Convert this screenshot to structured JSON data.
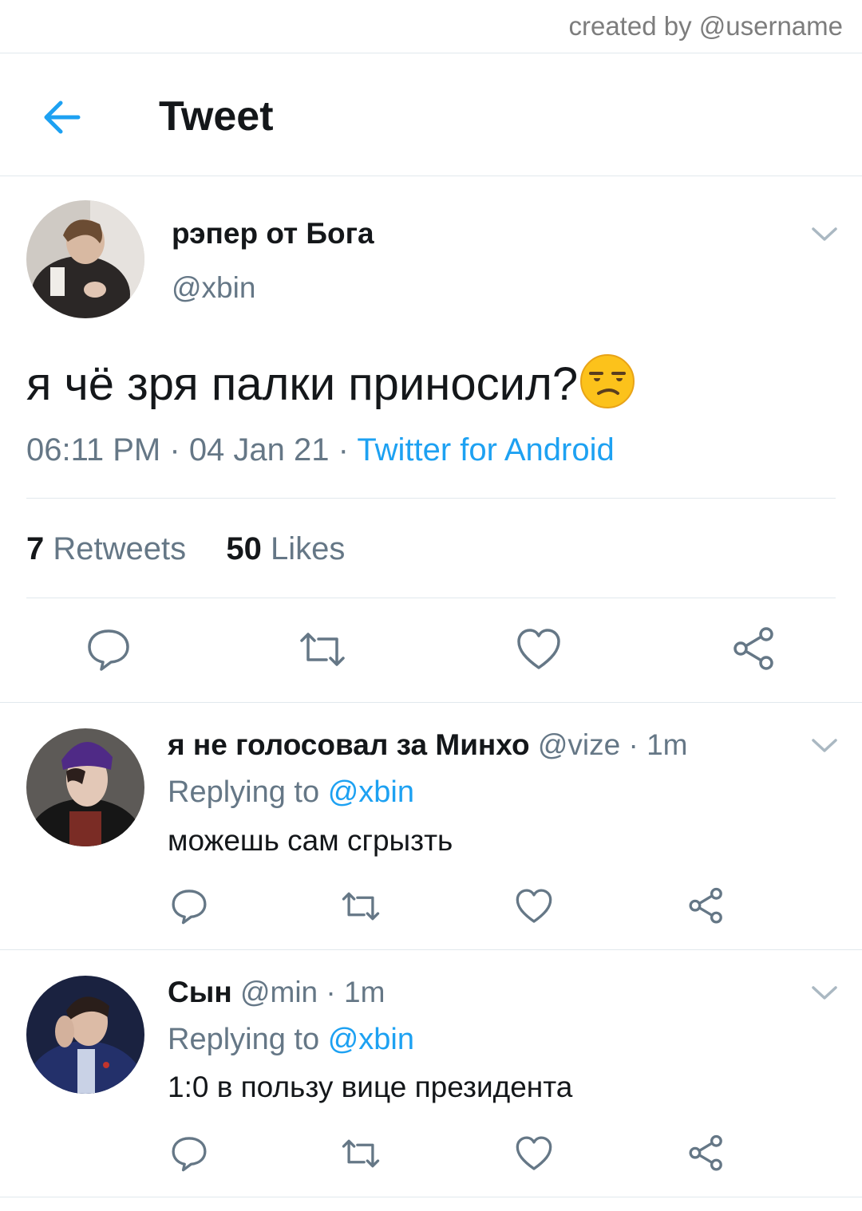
{
  "credit": "created by @username",
  "header": {
    "title": "Tweet",
    "back_icon": "back-arrow-icon"
  },
  "tweet": {
    "display_name": "рэпер от Бога",
    "handle": "@xbin",
    "text": "я чё зря палки приносил?",
    "emoji": "unamused-face-emoji",
    "time": "06:11 PM",
    "date": "04 Jan 21",
    "source": "Twitter for Android",
    "retweets_count": "7",
    "retweets_label": "Retweets",
    "likes_count": "50",
    "likes_label": "Likes"
  },
  "replies": [
    {
      "display_name": "я не голосовал за Минхо",
      "handle": "@vize",
      "age": "1m",
      "replying_to_label": "Replying to",
      "replying_to_handle": "@xbin",
      "text": "можешь сам сгрызть"
    },
    {
      "display_name": "Сын",
      "handle": "@min",
      "age": "1m",
      "replying_to_label": "Replying to",
      "replying_to_handle": "@xbin",
      "text": "1:0 в пользу вице президента"
    }
  ],
  "colors": {
    "accent": "#1da1f2",
    "secondary_text": "#657786",
    "divider": "#e1e8ed"
  }
}
